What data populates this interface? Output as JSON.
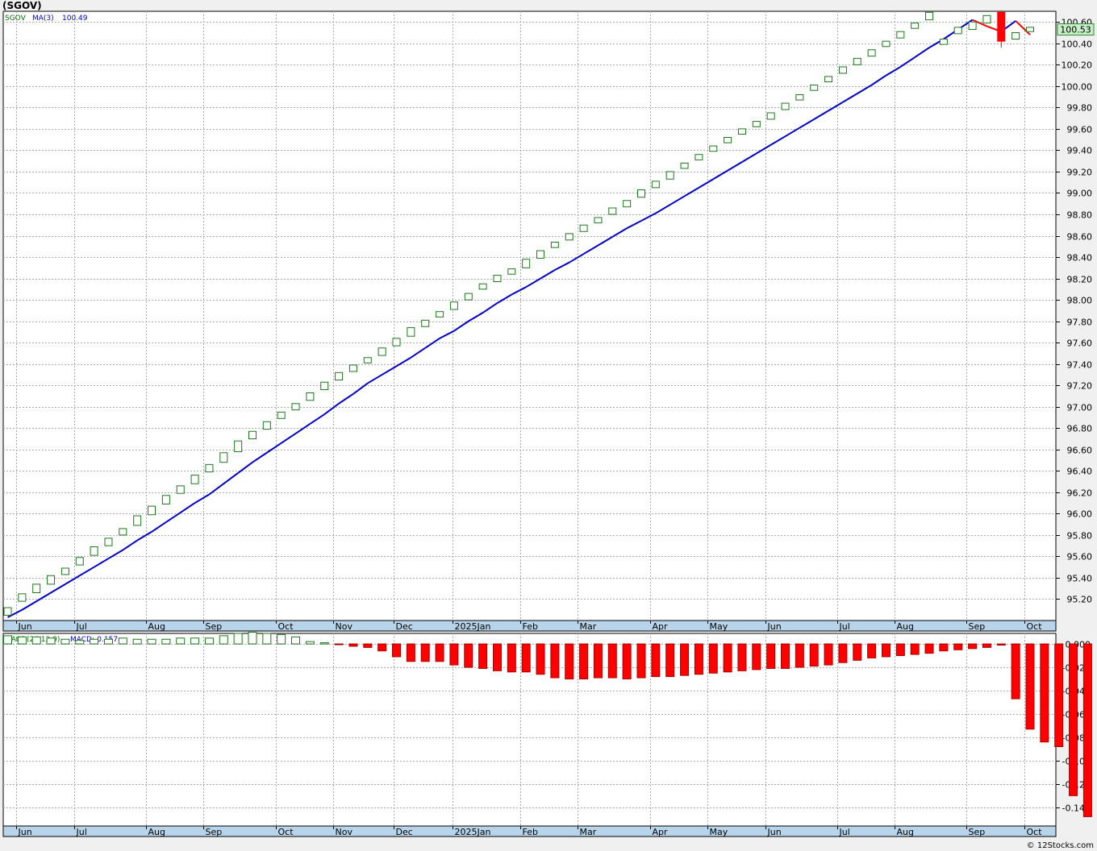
{
  "header": {
    "title": "(SGOV)"
  },
  "footer": {
    "credit": "© 12Stocks.com"
  },
  "colors": {
    "up": "#1a7a1a",
    "down": "#ff0000",
    "ma_up": "#0000cc",
    "ma_down": "#ff0000",
    "grid": "#aaaaaa",
    "axis_band": "#b8d4ea",
    "last_label_bg": "#c8f0c8"
  },
  "price_legend": {
    "symbol": "SGOV",
    "ma_label": "MA(3)",
    "ma_value": "100.49"
  },
  "price_last_label": "100.53",
  "macd_legend": {
    "label": "MACD(26,12,9)",
    "value_label": "MACD:-0.157"
  },
  "chart_data": [
    {
      "type": "candlestick",
      "title": "(SGOV)",
      "interval": "weekly",
      "x_labels": [
        "Jun",
        "Jul",
        "Aug",
        "Sep",
        "Oct",
        "Nov",
        "Dec",
        "2025Jan",
        "Feb",
        "Mar",
        "Apr",
        "May",
        "Jun",
        "Jul",
        "Aug",
        "Sep",
        "Oct"
      ],
      "ylim": [
        95.0,
        100.7
      ],
      "y_ticks": [
        "95.20",
        "95.40",
        "95.60",
        "95.80",
        "96.00",
        "96.20",
        "96.40",
        "96.60",
        "96.80",
        "97.00",
        "97.20",
        "97.40",
        "97.60",
        "97.80",
        "98.00",
        "98.20",
        "98.40",
        "98.60",
        "98.80",
        "99.00",
        "99.20",
        "99.40",
        "99.60",
        "99.80",
        "100.00",
        "100.20",
        "100.40",
        "100.60"
      ],
      "series": [
        {
          "name": "SGOV",
          "kind": "ohlc",
          "values": [
            {
              "o": 95.05,
              "c": 95.12
            },
            {
              "o": 95.18,
              "c": 95.25
            },
            {
              "o": 95.26,
              "c": 95.34
            },
            {
              "o": 95.34,
              "c": 95.42
            },
            {
              "o": 95.43,
              "c": 95.49
            },
            {
              "o": 95.52,
              "c": 95.59
            },
            {
              "o": 95.61,
              "c": 95.69
            },
            {
              "o": 95.7,
              "c": 95.77
            },
            {
              "o": 95.8,
              "c": 95.86
            },
            {
              "o": 95.89,
              "c": 95.98
            },
            {
              "o": 95.99,
              "c": 96.07
            },
            {
              "o": 96.09,
              "c": 96.17
            },
            {
              "o": 96.19,
              "c": 96.26
            },
            {
              "o": 96.28,
              "c": 96.36
            },
            {
              "o": 96.39,
              "c": 96.46
            },
            {
              "o": 96.48,
              "c": 96.57
            },
            {
              "o": 96.58,
              "c": 96.68
            },
            {
              "o": 96.7,
              "c": 96.77
            },
            {
              "o": 96.79,
              "c": 96.86
            },
            {
              "o": 96.89,
              "c": 96.95
            },
            {
              "o": 96.97,
              "c": 97.03
            },
            {
              "o": 97.06,
              "c": 97.13
            },
            {
              "o": 97.16,
              "c": 97.23
            },
            {
              "o": 97.25,
              "c": 97.32
            },
            {
              "o": 97.33,
              "c": 97.39
            },
            {
              "o": 97.41,
              "c": 97.46
            },
            {
              "o": 97.48,
              "c": 97.55
            },
            {
              "o": 97.57,
              "c": 97.64
            },
            {
              "o": 97.66,
              "c": 97.74
            },
            {
              "o": 97.75,
              "c": 97.81
            },
            {
              "o": 97.84,
              "c": 97.89
            },
            {
              "o": 97.91,
              "c": 97.98
            },
            {
              "o": 98.0,
              "c": 98.06
            },
            {
              "o": 98.1,
              "c": 98.15
            },
            {
              "o": 98.17,
              "c": 98.23
            },
            {
              "o": 98.24,
              "c": 98.29
            },
            {
              "o": 98.3,
              "c": 98.38
            },
            {
              "o": 98.39,
              "c": 98.46
            },
            {
              "o": 98.49,
              "c": 98.54
            },
            {
              "o": 98.56,
              "c": 98.62
            },
            {
              "o": 98.64,
              "c": 98.7
            },
            {
              "o": 98.72,
              "c": 98.77
            },
            {
              "o": 98.8,
              "c": 98.86
            },
            {
              "o": 98.87,
              "c": 98.93
            },
            {
              "o": 98.96,
              "c": 99.03
            },
            {
              "o": 99.05,
              "c": 99.11
            },
            {
              "o": 99.13,
              "c": 99.2
            },
            {
              "o": 99.23,
              "c": 99.28
            },
            {
              "o": 99.31,
              "c": 99.36
            },
            {
              "o": 99.39,
              "c": 99.44
            },
            {
              "o": 99.47,
              "c": 99.52
            },
            {
              "o": 99.55,
              "c": 99.6
            },
            {
              "o": 99.62,
              "c": 99.67
            },
            {
              "o": 99.69,
              "c": 99.75
            },
            {
              "o": 99.78,
              "c": 99.84
            },
            {
              "o": 99.87,
              "c": 99.92
            },
            {
              "o": 99.96,
              "c": 100.01
            },
            {
              "o": 100.04,
              "c": 100.09
            },
            {
              "o": 100.12,
              "c": 100.18
            },
            {
              "o": 100.2,
              "c": 100.26
            },
            {
              "o": 100.28,
              "c": 100.34
            },
            {
              "o": 100.37,
              "c": 100.42
            },
            {
              "o": 100.45,
              "c": 100.51
            },
            {
              "o": 100.54,
              "c": 100.59
            },
            {
              "o": 100.62,
              "c": 100.69
            },
            {
              "o": 100.39,
              "c": 100.44
            },
            {
              "o": 100.49,
              "c": 100.55
            },
            {
              "o": 100.53,
              "c": 100.6
            },
            {
              "o": 100.59,
              "c": 100.66
            },
            {
              "o": 100.69,
              "c": 100.42,
              "h": 100.7,
              "l": 100.36
            },
            {
              "o": 100.44,
              "c": 100.5
            },
            {
              "o": 100.51,
              "c": 100.55
            }
          ]
        },
        {
          "name": "MA(3)",
          "kind": "line",
          "values": [
            95.03,
            95.1,
            95.18,
            95.26,
            95.34,
            95.42,
            95.5,
            95.58,
            95.66,
            95.75,
            95.83,
            95.92,
            96.01,
            96.1,
            96.18,
            96.28,
            96.38,
            96.48,
            96.57,
            96.66,
            96.75,
            96.84,
            96.93,
            97.03,
            97.12,
            97.22,
            97.3,
            97.38,
            97.46,
            97.55,
            97.64,
            97.71,
            97.8,
            97.88,
            97.97,
            98.05,
            98.12,
            98.2,
            98.28,
            98.35,
            98.43,
            98.51,
            98.59,
            98.67,
            98.74,
            98.81,
            98.89,
            98.97,
            99.05,
            99.13,
            99.21,
            99.29,
            99.37,
            99.45,
            99.53,
            99.61,
            99.69,
            99.77,
            99.85,
            99.93,
            100.01,
            100.1,
            100.18,
            100.27,
            100.36,
            100.44,
            100.53,
            100.62,
            100.56,
            100.51,
            100.61,
            100.48
          ]
        }
      ]
    },
    {
      "type": "bar",
      "title": "MACD(26,12,9)",
      "x_labels": [
        "Jun",
        "Jul",
        "Aug",
        "Sep",
        "Oct",
        "Nov",
        "Dec",
        "2025Jan",
        "Feb",
        "Mar",
        "Apr",
        "May",
        "Jun",
        "Jul",
        "Aug",
        "Sep",
        "Oct"
      ],
      "ylim": [
        -0.156,
        0.009
      ],
      "y_ticks": [
        "0.000",
        "-0.020",
        "-0.040",
        "-0.060",
        "-0.080",
        "-0.100",
        "-0.120",
        "-0.140"
      ],
      "series": [
        {
          "name": "MACD",
          "values": [
            0.007,
            0.006,
            0.006,
            0.005,
            0.004,
            0.003,
            0.004,
            0.004,
            0.005,
            0.004,
            0.004,
            0.004,
            0.005,
            0.005,
            0.005,
            0.007,
            0.009,
            0.01,
            0.009,
            0.008,
            0.006,
            0.002,
            0.001,
            -0.0005,
            -0.002,
            -0.003,
            -0.006,
            -0.011,
            -0.015,
            -0.015,
            -0.015,
            -0.018,
            -0.02,
            -0.021,
            -0.023,
            -0.024,
            -0.024,
            -0.026,
            -0.029,
            -0.03,
            -0.03,
            -0.029,
            -0.029,
            -0.03,
            -0.029,
            -0.028,
            -0.028,
            -0.027,
            -0.026,
            -0.025,
            -0.024,
            -0.023,
            -0.022,
            -0.021,
            -0.021,
            -0.02,
            -0.019,
            -0.018,
            -0.016,
            -0.014,
            -0.012,
            -0.011,
            -0.01,
            -0.009,
            -0.008,
            -0.006,
            -0.005,
            -0.004,
            -0.003,
            -0.001,
            -0.047,
            -0.073,
            -0.084,
            -0.088,
            -0.13,
            -0.148,
            -0.157
          ]
        }
      ]
    }
  ]
}
